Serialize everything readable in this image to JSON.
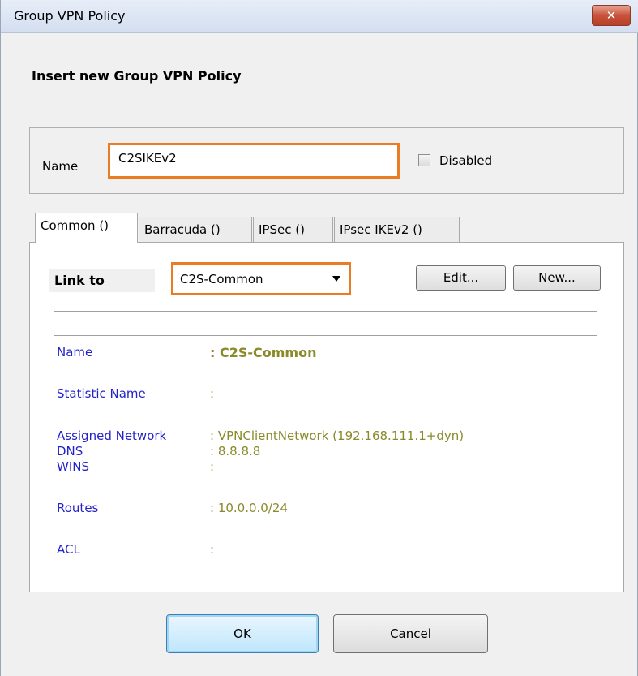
{
  "window": {
    "title": "Group VPN Policy",
    "close_symbol": "✕"
  },
  "heading": "Insert new Group VPN Policy",
  "name_field": {
    "label": "Name",
    "value": "C2SIKEv2"
  },
  "disabled_checkbox": {
    "label": "Disabled",
    "checked": false
  },
  "tabs": [
    {
      "label": "Common ()",
      "active": true
    },
    {
      "label": "Barracuda ()",
      "active": false
    },
    {
      "label": "IPSec ()",
      "active": false
    },
    {
      "label": "IPsec IKEv2 ()",
      "active": false
    }
  ],
  "link_to": {
    "label": "Link to",
    "selected": "C2S-Common",
    "edit_label": "Edit...",
    "new_label": "New..."
  },
  "info": [
    {
      "label": "Name",
      "value": ": C2S-Common"
    },
    {
      "label": "Statistic Name",
      "value": ":"
    },
    {
      "label": "Assigned Network",
      "value": ": VPNClientNetwork (192.168.111.1+dyn)"
    },
    {
      "label": "DNS",
      "value": ": 8.8.8.8"
    },
    {
      "label": "WINS",
      "value": ":"
    },
    {
      "label": "Routes",
      "value": ": 10.0.0.0/24"
    },
    {
      "label": "ACL",
      "value": ":"
    }
  ],
  "buttons": {
    "ok": "OK",
    "cancel": "Cancel"
  },
  "colors": {
    "highlight_border": "#ea7d24",
    "info_label": "#2323c8",
    "info_value": "#8a8a2a"
  }
}
